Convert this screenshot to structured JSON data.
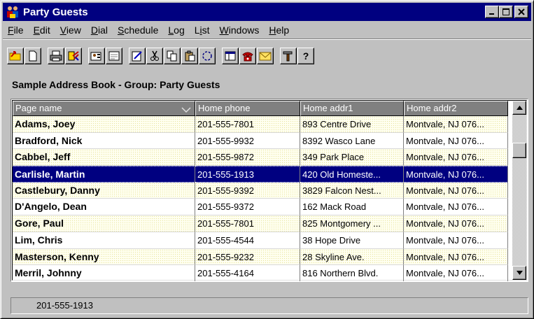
{
  "window": {
    "title": "Party Guests",
    "minimize": "_",
    "maximize": "□",
    "close": "✕"
  },
  "menu": [
    {
      "label": "File",
      "underline": "F",
      "rest": "ile"
    },
    {
      "label": "Edit",
      "underline": "E",
      "rest": "dit"
    },
    {
      "label": "View",
      "underline": "V",
      "rest": "iew"
    },
    {
      "label": "Dial",
      "underline": "D",
      "rest": "ial"
    },
    {
      "label": "Schedule",
      "underline": "S",
      "rest": "chedule"
    },
    {
      "label": "Log",
      "underline": "L",
      "rest": "og"
    },
    {
      "label": "List",
      "pre": "L",
      "underline": "i",
      "rest": "st"
    },
    {
      "label": "Windows",
      "underline": "W",
      "rest": "indows"
    },
    {
      "label": "Help",
      "underline": "H",
      "rest": "elp"
    }
  ],
  "toolbar": {
    "icons": [
      "open-folder-icon",
      "new-page-icon",
      "print-icon",
      "print-setup-icon",
      "address-card-icon",
      "form-icon",
      "edit-pencil-icon",
      "cut-icon",
      "copy-icon",
      "paste-icon",
      "refresh-icon",
      "columns-icon",
      "dial-phone-icon",
      "email-icon",
      "tools-icon",
      "help-icon"
    ],
    "help_label": "?"
  },
  "group_label": "Sample Address Book - Group: Party Guests",
  "list": {
    "columns": [
      "Page name",
      "Home phone",
      "Home addr1",
      "Home addr2"
    ],
    "rows": [
      {
        "name": "Adams, Joey",
        "phone": "201-555-7801",
        "addr1": "893 Centre Drive",
        "addr2": "Montvale, NJ 076..."
      },
      {
        "name": "Bradford, Nick",
        "phone": "201-555-9932",
        "addr1": "8392 Wasco Lane",
        "addr2": "Montvale, NJ 076..."
      },
      {
        "name": "Cabbel, Jeff",
        "phone": "201-555-9872",
        "addr1": "349 Park Place",
        "addr2": "Montvale, NJ 076..."
      },
      {
        "name": "Carlisle, Martin",
        "phone": "201-555-1913",
        "addr1": "420 Old Homeste...",
        "addr2": "Montvale, NJ 076..."
      },
      {
        "name": "Castlebury, Danny",
        "phone": "201-555-9392",
        "addr1": "3829 Falcon Nest...",
        "addr2": "Montvale, NJ 076..."
      },
      {
        "name": "D'Angelo, Dean",
        "phone": "201-555-9372",
        "addr1": "162 Mack Road",
        "addr2": "Montvale, NJ 076..."
      },
      {
        "name": "Gore, Paul",
        "phone": "201-555-7801",
        "addr1": "825 Montgomery ...",
        "addr2": "Montvale, NJ 076..."
      },
      {
        "name": "Lim, Chris",
        "phone": "201-555-4544",
        "addr1": "38 Hope Drive",
        "addr2": "Montvale, NJ 076..."
      },
      {
        "name": "Masterson, Kenny",
        "phone": "201-555-9232",
        "addr1": "28 Skyline Ave.",
        "addr2": "Montvale, NJ 076..."
      },
      {
        "name": "Merril, Johnny",
        "phone": "201-555-4164",
        "addr1": "816 Northern Blvd.",
        "addr2": "Montvale, NJ 076..."
      }
    ],
    "selected_index": 3
  },
  "status": {
    "text": "201-555-1913"
  },
  "colors": {
    "titlebar": "#000080",
    "selection": "#000080",
    "alt_row": "#fffff0"
  }
}
